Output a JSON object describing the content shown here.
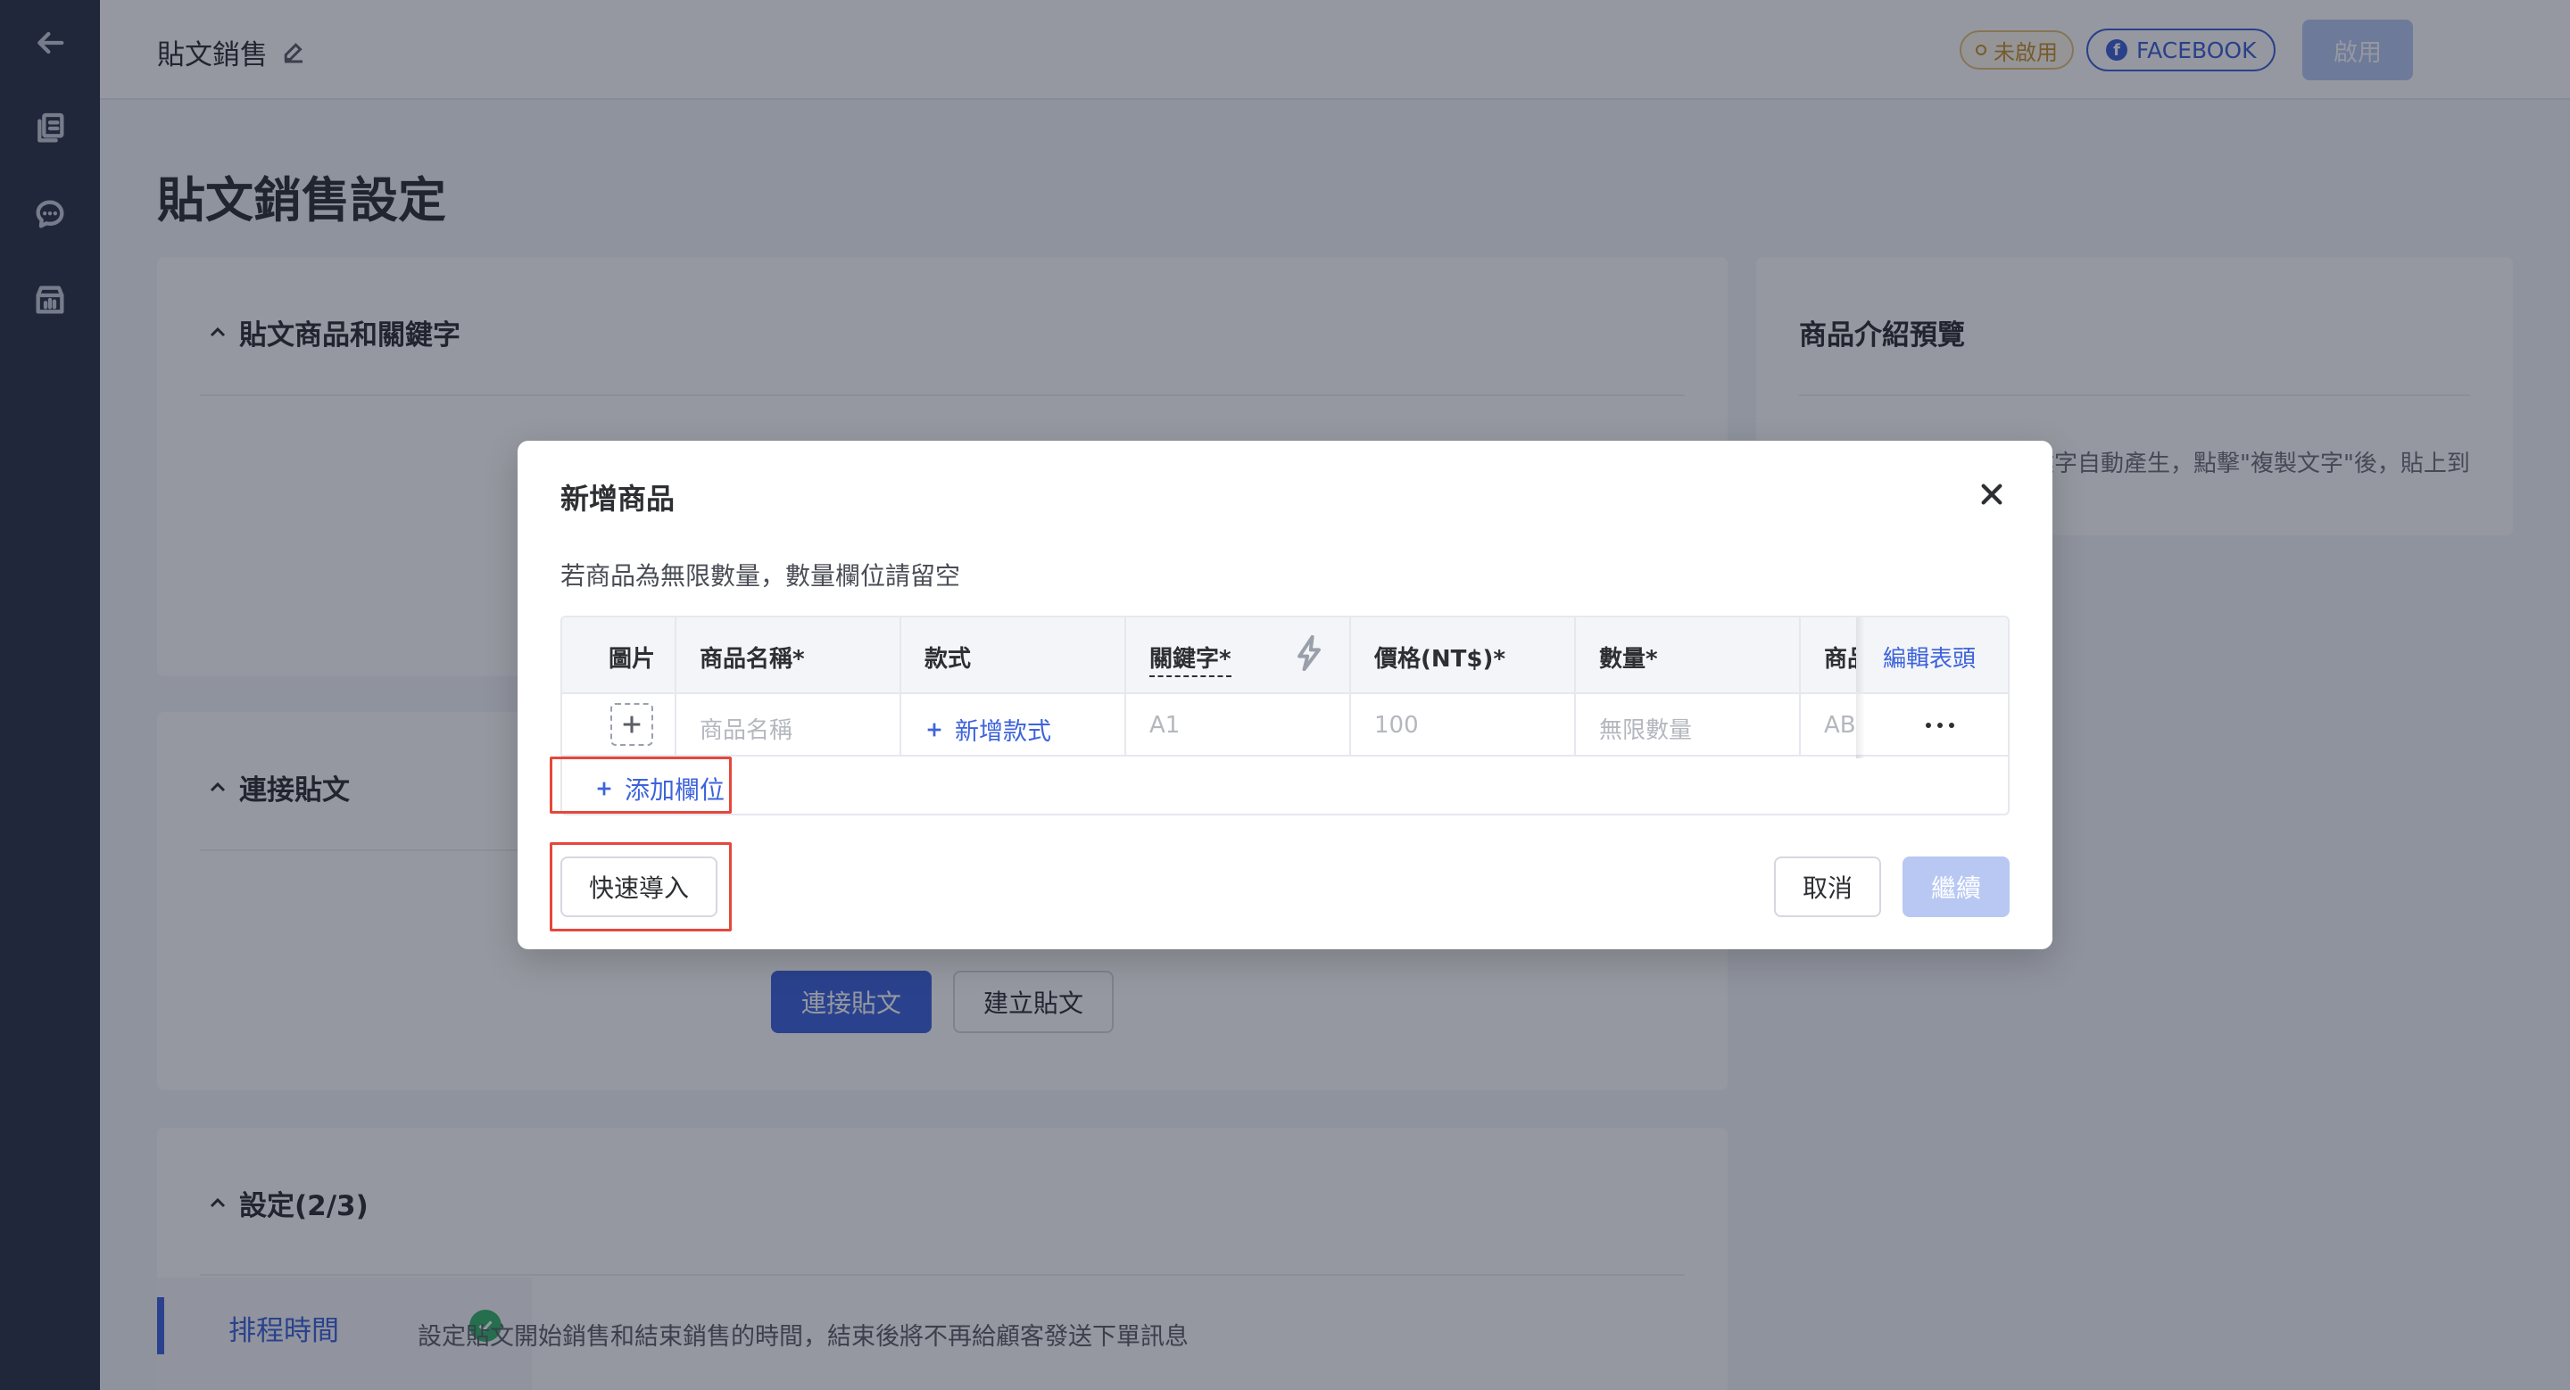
{
  "topbar": {
    "title": "貼文銷售",
    "status_badge": "未啟用",
    "platform_badge": "FACEBOOK",
    "enable_label": "啟用"
  },
  "page": {
    "title": "貼文銷售設定"
  },
  "sections": {
    "products": {
      "title": "貼文商品和關鍵字"
    },
    "connect": {
      "title": "連接貼文",
      "connect_button": "連接貼文",
      "create_button": "建立貼文"
    },
    "settings": {
      "title": "設定(2/3)",
      "nav_item": "排程時間",
      "description": "設定貼文開始銷售和結束銷售的時間，結束後將不再給顧客發送下單訊息"
    },
    "preview": {
      "title": "商品介紹預覽",
      "description": "根據左側已選商品及關鍵字自動產生，點擊\"複製文字\"後，貼上到您的貼文中。"
    }
  },
  "modal": {
    "title": "新增商品",
    "hint": "若商品為無限數量，數量欄位請留空",
    "table": {
      "headers": {
        "image": "圖片",
        "name": "商品名稱*",
        "variant": "款式",
        "keyword": "關鍵字*",
        "price": "價格(NT$)*",
        "quantity": "數量*",
        "sku": "商品",
        "edit_header": "編輯表頭"
      },
      "row": {
        "name_placeholder": "商品名稱",
        "add_variant": "新增款式",
        "keyword_placeholder": "A1",
        "price_placeholder": "100",
        "quantity_placeholder": "無限數量",
        "sku_placeholder": "AB"
      }
    },
    "add_field": "添加欄位",
    "quick_import": "快速導入",
    "cancel": "取消",
    "continue": "繼續"
  },
  "colors": {
    "primary": "#3d63dc",
    "rail": "#2b3247",
    "highlight": "#e5473c",
    "success": "#33b26b"
  }
}
